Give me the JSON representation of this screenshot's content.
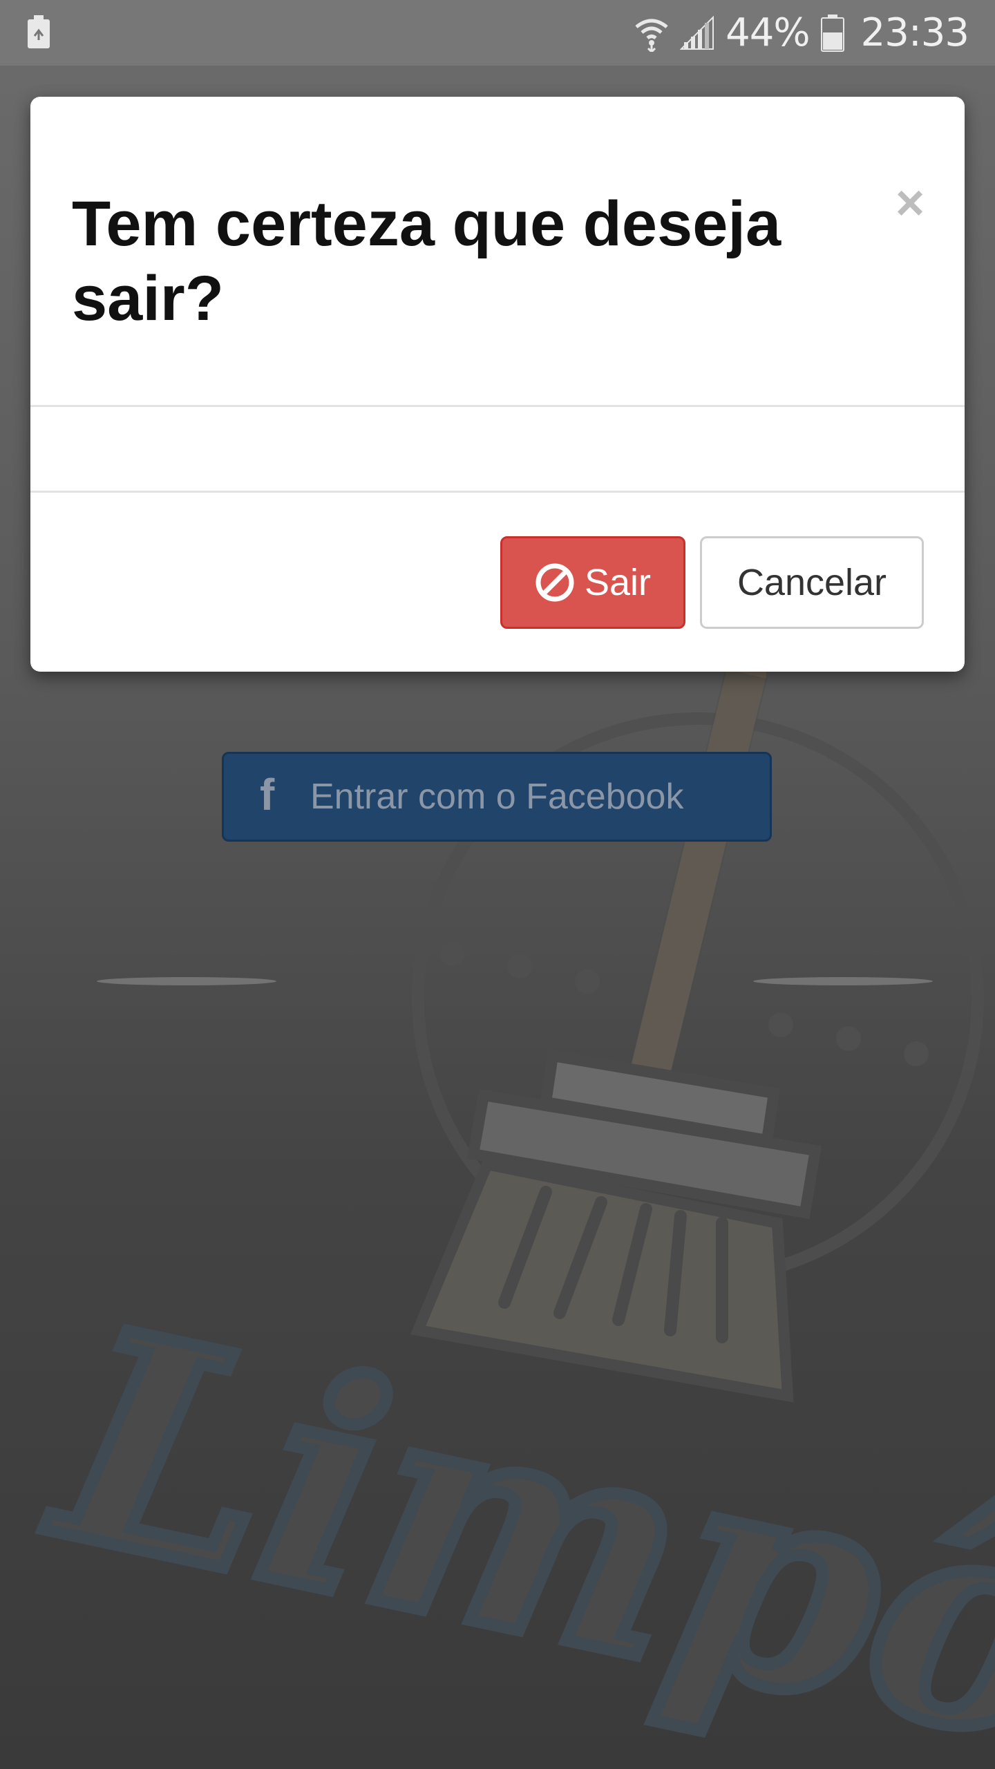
{
  "status_bar": {
    "left_icon": "battery-saver-icon",
    "wifi_icon": "wifi-icon",
    "signal_icon": "signal-icon",
    "battery_percent": "44%",
    "battery_icon": "battery-icon",
    "time": "23:33"
  },
  "background": {
    "facebook_button": {
      "icon": "f",
      "label": "Entrar com o Facebook"
    },
    "logo_text": "Limpô"
  },
  "modal": {
    "title": "Tem certeza que deseja sair?",
    "close_symbol": "×",
    "exit_button_label": "Sair",
    "cancel_button_label": "Cancelar"
  },
  "colors": {
    "danger": "#d9534f",
    "facebook": "#21446b",
    "overlay": "#5a5a5a"
  }
}
